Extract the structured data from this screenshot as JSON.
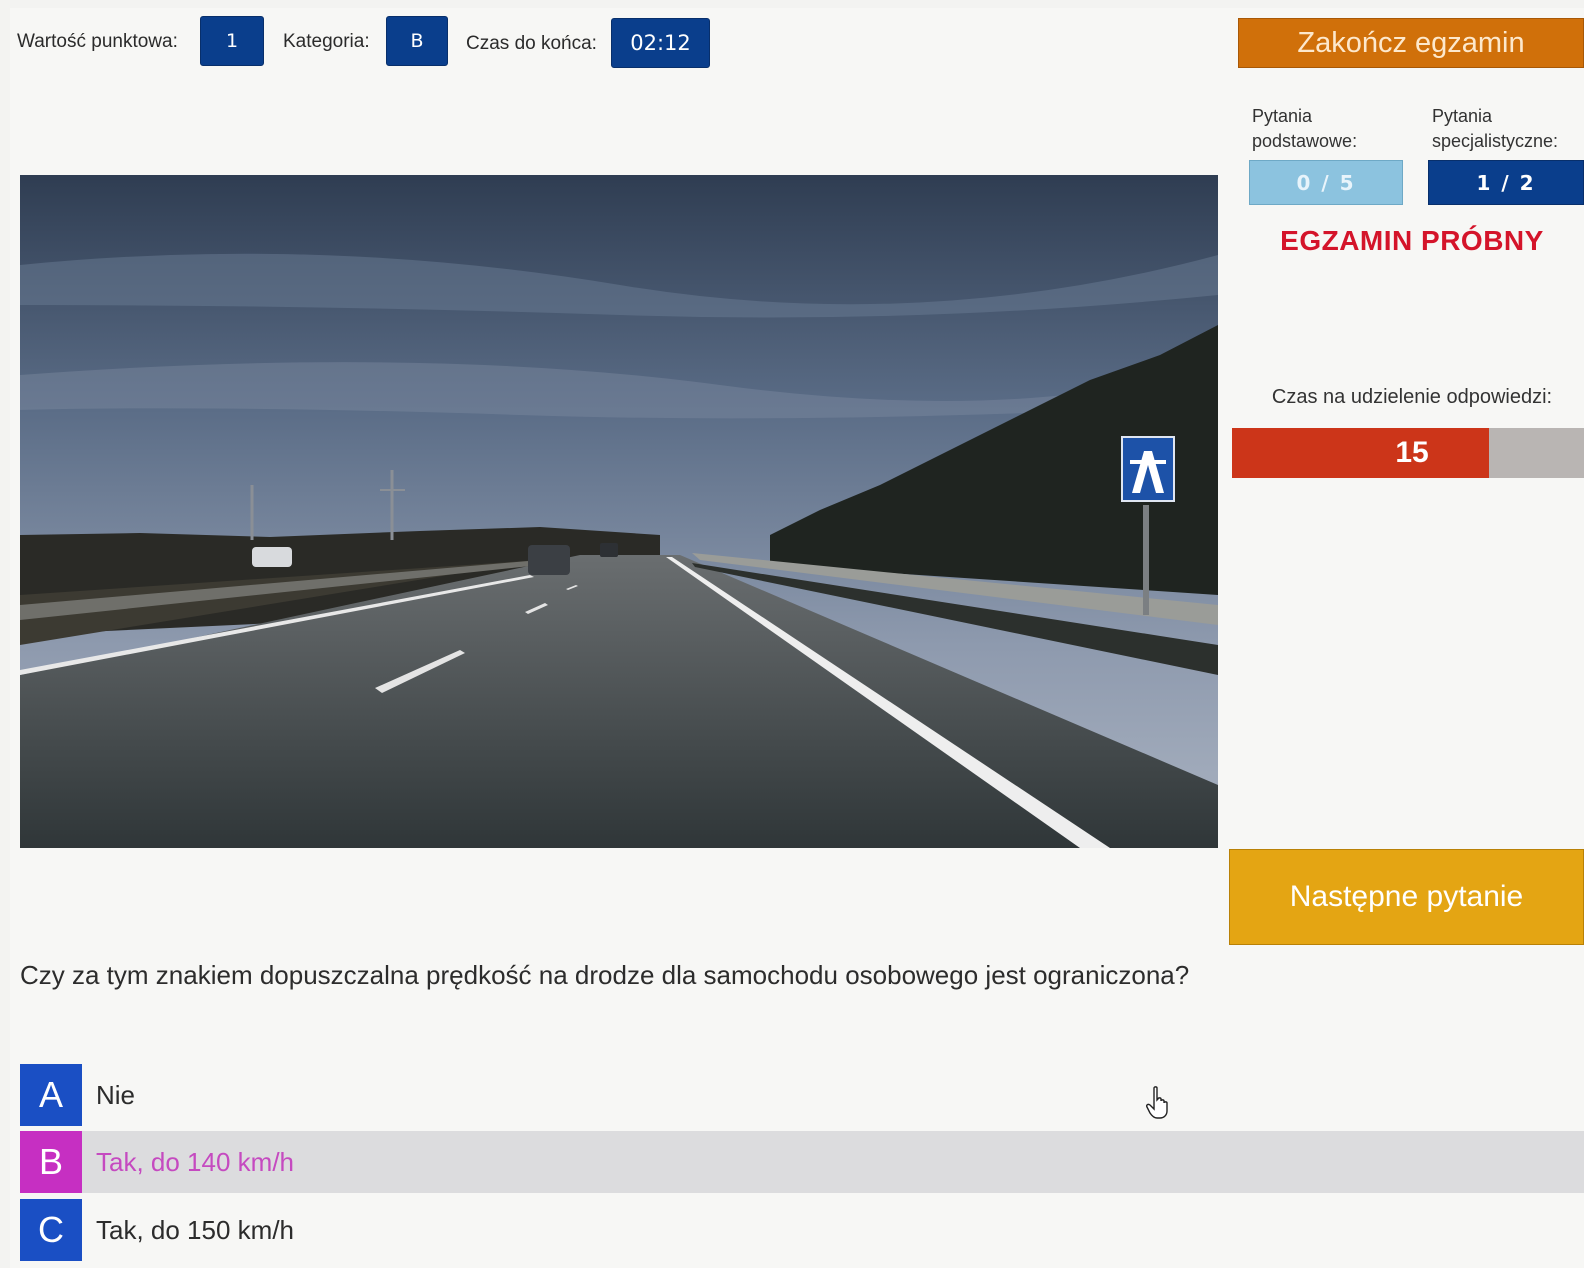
{
  "header": {
    "points_label": "Wartość punktowa:",
    "points_value": "1",
    "category_label": "Kategoria:",
    "category_value": "B",
    "time_label": "Czas do końca:",
    "time_value": "02:12",
    "end_button": "Zakończ egzamin"
  },
  "progress": {
    "basic_label": "Pytania podstawowe:",
    "basic_value": "0 / 5",
    "special_label": "Pytania specjalistyczne:",
    "special_value": "1 / 2"
  },
  "mode_banner": "EGZAMIN PRÓBNY",
  "answer_timer": {
    "label": "Czas na udzielenie odpowiedzi:",
    "seconds": "15",
    "remaining_fraction": 0.73
  },
  "next_button": "Następne pytanie",
  "question": "Czy za tym znakiem dopuszczalna prędkość na drodze dla samochodu osobowego jest ograniczona?",
  "answers": [
    {
      "letter": "A",
      "text": "Nie"
    },
    {
      "letter": "B",
      "text": "Tak, do 140 km/h"
    },
    {
      "letter": "C",
      "text": "Tak, do 150 km/h"
    }
  ],
  "selected_answer": "B",
  "colors": {
    "chip": "#0a3e8c",
    "end_button": "#d0700a",
    "basic_counter": "#8cc3df",
    "special_counter": "#0a3e8c",
    "banner": "#d4142a",
    "timer_fill": "#cc3519",
    "next_button": "#e4a513",
    "answer_letter": "#1a4fc4",
    "answer_letter_selected": "#c62fc2"
  },
  "icons": [
    "motorway-sign-icon",
    "hand-pointer-icon"
  ]
}
